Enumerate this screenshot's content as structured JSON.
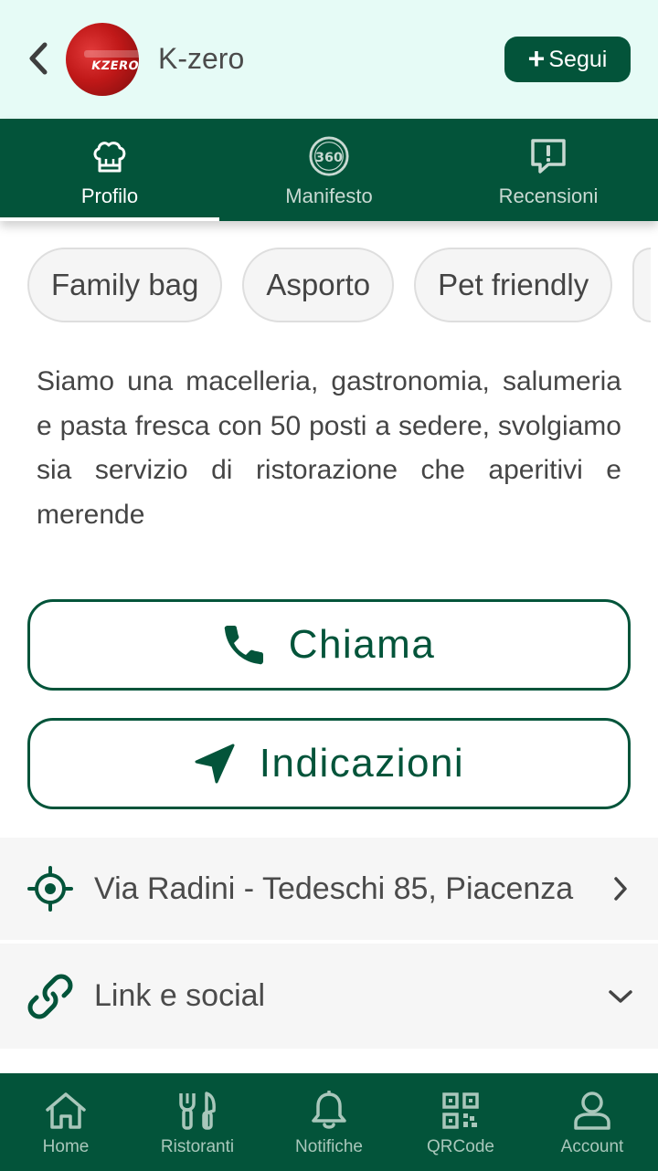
{
  "header": {
    "title": "K-zero",
    "avatar_logo_text": "KZERO",
    "follow_label": "Segui"
  },
  "tabs": [
    {
      "label": "Profilo",
      "icon": "chef-hat-icon",
      "active": true
    },
    {
      "label": "Manifesto",
      "icon": "360-badge-icon",
      "badge_text": "360",
      "active": false
    },
    {
      "label": "Recensioni",
      "icon": "review-alert-icon",
      "active": false
    }
  ],
  "chips": [
    "Family bag",
    "Asporto",
    "Pet friendly"
  ],
  "description": "Siamo una macelleria, gastronomia, salumeria e pasta fresca con 50 posti a sedere, svolgiamo sia servizio di ristorazione che aperitivi e merende",
  "actions": {
    "call_label": "Chiama",
    "directions_label": "Indicazioni"
  },
  "address": {
    "text": "Via Radini - Tedeschi 85, Piacenza"
  },
  "links": {
    "label": "Link e social"
  },
  "bottom_nav": [
    {
      "label": "Home",
      "icon": "home-icon"
    },
    {
      "label": "Ristoranti",
      "icon": "cutlery-icon"
    },
    {
      "label": "Notifiche",
      "icon": "bell-icon"
    },
    {
      "label": "QRCode",
      "icon": "qrcode-icon"
    },
    {
      "label": "Account",
      "icon": "user-icon"
    }
  ],
  "colors": {
    "brand_green": "#03543a",
    "header_bg": "#e6fbf6",
    "row_bg": "#f6f6f6"
  }
}
